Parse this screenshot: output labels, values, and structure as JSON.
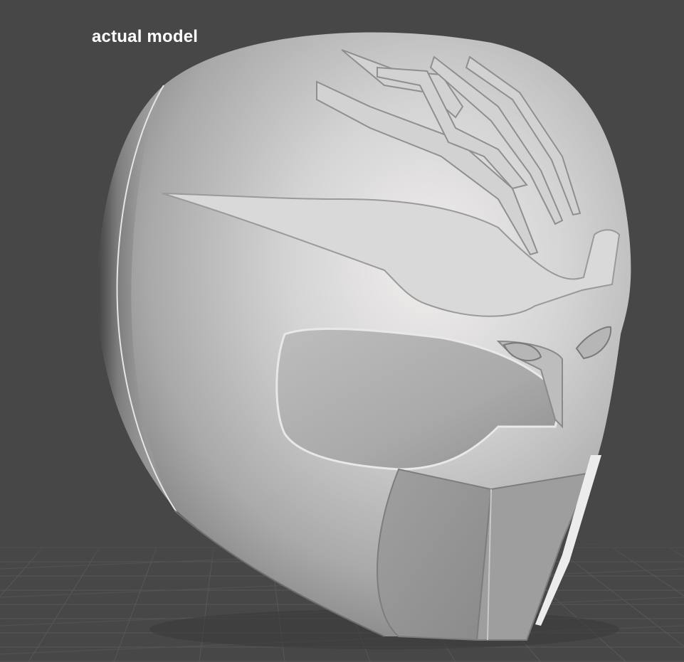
{
  "viewport": {
    "label": "actual model",
    "background_color": "#474747",
    "grid_color": "#5a5a5a",
    "model_color": "#c8c8c8"
  }
}
